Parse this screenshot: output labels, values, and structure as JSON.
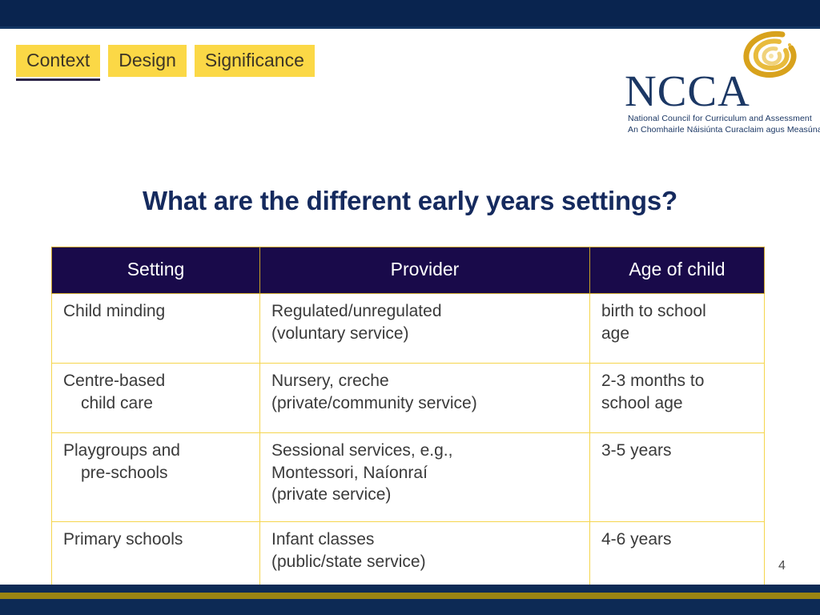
{
  "theme": {
    "navy_bar": "#0d2a55",
    "gold_bar": "#9a8412",
    "tab_yellow": "#fbd846",
    "table_header_bg": "#190a4a",
    "table_border_gold": "#f5d54d",
    "title_navy": "#152a5e"
  },
  "nav": {
    "tabs": [
      {
        "label": "Context",
        "active": true
      },
      {
        "label": "Design",
        "active": false
      },
      {
        "label": "Significance",
        "active": false
      }
    ]
  },
  "logo": {
    "icon_name": "ncca-swirl-icon",
    "wordmark": "NCCA",
    "subtitle_en": "National Council for Curriculum and Assessment",
    "subtitle_ga": "An Chomhairle Náisiúnta Curaclaim agus Measúnachta"
  },
  "slide": {
    "title": "What are the different early years settings?",
    "page_number": "4"
  },
  "table": {
    "headers": [
      "Setting",
      "Provider",
      "Age of child"
    ],
    "rows": [
      {
        "setting_line1": "Child minding",
        "setting_line2": "",
        "provider_line1": "Regulated/unregulated",
        "provider_line2": "(voluntary service)",
        "provider_line3": "",
        "age_line1": "birth to school",
        "age_line2": "age"
      },
      {
        "setting_line1": "Centre-based",
        "setting_line2": "child care",
        "provider_line1": "Nursery, creche",
        "provider_line2": "(private/community service)",
        "provider_line3": "",
        "age_line1": "2-3 months to",
        "age_line2": "school age"
      },
      {
        "setting_line1": "Playgroups and",
        "setting_line2": "pre-schools",
        "provider_line1": "Sessional services, e.g.,",
        "provider_line2": "Montessori, Naíonraí",
        "provider_line3": "(private service)",
        "age_line1": "3-5 years",
        "age_line2": ""
      },
      {
        "setting_line1": "Primary schools",
        "setting_line2": "",
        "provider_line1": "Infant classes",
        "provider_line2": "(public/state service)",
        "provider_line3": "",
        "age_line1": "4-6 years",
        "age_line2": ""
      }
    ]
  }
}
